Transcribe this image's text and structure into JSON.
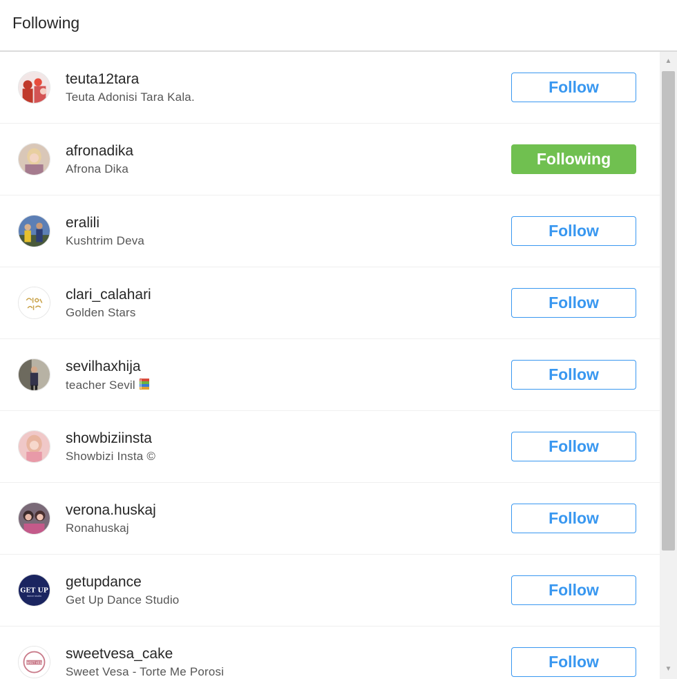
{
  "header": {
    "title": "Following"
  },
  "rows": [
    {
      "username": "teuta12tara",
      "fullname": "Teuta Adonisi Tara Kala.",
      "button": "Follow",
      "state": "follow",
      "avatar_icon": "avatar-photo-group"
    },
    {
      "username": "afronadika",
      "fullname": "Afrona Dika",
      "button": "Following",
      "state": "following",
      "avatar_icon": "avatar-photo-woman"
    },
    {
      "username": "eralili",
      "fullname": "Kushtrim Deva",
      "button": "Follow",
      "state": "follow",
      "avatar_icon": "avatar-photo-people"
    },
    {
      "username": "clari_calahari",
      "fullname": "Golden Stars",
      "button": "Follow",
      "state": "follow",
      "avatar_icon": "golden-stars-logo"
    },
    {
      "username": "sevilhaxhija",
      "fullname": "teacher Sevil",
      "fullname_emoji": "books-emoji",
      "button": "Follow",
      "state": "follow",
      "avatar_icon": "avatar-photo-person"
    },
    {
      "username": "showbiziinsta",
      "fullname": "Showbizi Insta ©",
      "button": "Follow",
      "state": "follow",
      "avatar_icon": "avatar-photo-woman"
    },
    {
      "username": "verona.huskaj",
      "fullname": "Ronahuskaj",
      "button": "Follow",
      "state": "follow",
      "avatar_icon": "avatar-photo-group"
    },
    {
      "username": "getupdance",
      "fullname": "Get Up Dance Studio",
      "button": "Follow",
      "state": "follow",
      "avatar_icon": "get-up-logo"
    },
    {
      "username": "sweetvesa_cake",
      "fullname": "Sweet Vesa - Torte Me Porosi",
      "button": "Follow",
      "state": "follow",
      "avatar_icon": "sweet-vesa-logo"
    }
  ],
  "colors": {
    "follow_blue": "#3897f0",
    "following_green": "#70c050"
  }
}
